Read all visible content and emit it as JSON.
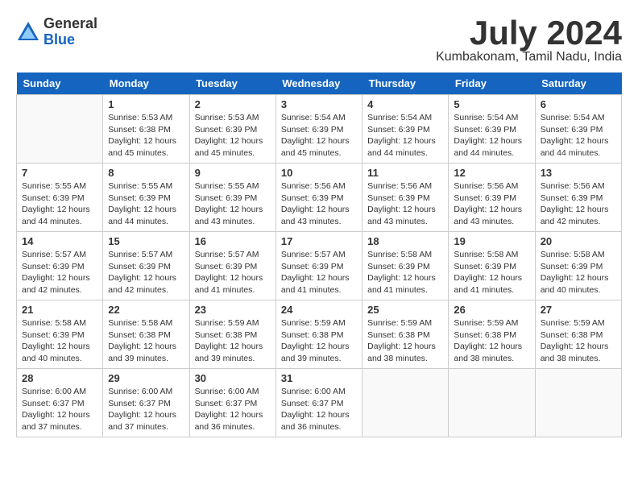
{
  "logo": {
    "general": "General",
    "blue": "Blue"
  },
  "title": "July 2024",
  "location": "Kumbakonam, Tamil Nadu, India",
  "headers": [
    "Sunday",
    "Monday",
    "Tuesday",
    "Wednesday",
    "Thursday",
    "Friday",
    "Saturday"
  ],
  "weeks": [
    [
      {
        "day": "",
        "info": ""
      },
      {
        "day": "1",
        "info": "Sunrise: 5:53 AM\nSunset: 6:38 PM\nDaylight: 12 hours\nand 45 minutes."
      },
      {
        "day": "2",
        "info": "Sunrise: 5:53 AM\nSunset: 6:39 PM\nDaylight: 12 hours\nand 45 minutes."
      },
      {
        "day": "3",
        "info": "Sunrise: 5:54 AM\nSunset: 6:39 PM\nDaylight: 12 hours\nand 45 minutes."
      },
      {
        "day": "4",
        "info": "Sunrise: 5:54 AM\nSunset: 6:39 PM\nDaylight: 12 hours\nand 44 minutes."
      },
      {
        "day": "5",
        "info": "Sunrise: 5:54 AM\nSunset: 6:39 PM\nDaylight: 12 hours\nand 44 minutes."
      },
      {
        "day": "6",
        "info": "Sunrise: 5:54 AM\nSunset: 6:39 PM\nDaylight: 12 hours\nand 44 minutes."
      }
    ],
    [
      {
        "day": "7",
        "info": "Sunrise: 5:55 AM\nSunset: 6:39 PM\nDaylight: 12 hours\nand 44 minutes."
      },
      {
        "day": "8",
        "info": "Sunrise: 5:55 AM\nSunset: 6:39 PM\nDaylight: 12 hours\nand 44 minutes."
      },
      {
        "day": "9",
        "info": "Sunrise: 5:55 AM\nSunset: 6:39 PM\nDaylight: 12 hours\nand 43 minutes."
      },
      {
        "day": "10",
        "info": "Sunrise: 5:56 AM\nSunset: 6:39 PM\nDaylight: 12 hours\nand 43 minutes."
      },
      {
        "day": "11",
        "info": "Sunrise: 5:56 AM\nSunset: 6:39 PM\nDaylight: 12 hours\nand 43 minutes."
      },
      {
        "day": "12",
        "info": "Sunrise: 5:56 AM\nSunset: 6:39 PM\nDaylight: 12 hours\nand 43 minutes."
      },
      {
        "day": "13",
        "info": "Sunrise: 5:56 AM\nSunset: 6:39 PM\nDaylight: 12 hours\nand 42 minutes."
      }
    ],
    [
      {
        "day": "14",
        "info": "Sunrise: 5:57 AM\nSunset: 6:39 PM\nDaylight: 12 hours\nand 42 minutes."
      },
      {
        "day": "15",
        "info": "Sunrise: 5:57 AM\nSunset: 6:39 PM\nDaylight: 12 hours\nand 42 minutes."
      },
      {
        "day": "16",
        "info": "Sunrise: 5:57 AM\nSunset: 6:39 PM\nDaylight: 12 hours\nand 41 minutes."
      },
      {
        "day": "17",
        "info": "Sunrise: 5:57 AM\nSunset: 6:39 PM\nDaylight: 12 hours\nand 41 minutes."
      },
      {
        "day": "18",
        "info": "Sunrise: 5:58 AM\nSunset: 6:39 PM\nDaylight: 12 hours\nand 41 minutes."
      },
      {
        "day": "19",
        "info": "Sunrise: 5:58 AM\nSunset: 6:39 PM\nDaylight: 12 hours\nand 41 minutes."
      },
      {
        "day": "20",
        "info": "Sunrise: 5:58 AM\nSunset: 6:39 PM\nDaylight: 12 hours\nand 40 minutes."
      }
    ],
    [
      {
        "day": "21",
        "info": "Sunrise: 5:58 AM\nSunset: 6:39 PM\nDaylight: 12 hours\nand 40 minutes."
      },
      {
        "day": "22",
        "info": "Sunrise: 5:58 AM\nSunset: 6:38 PM\nDaylight: 12 hours\nand 39 minutes."
      },
      {
        "day": "23",
        "info": "Sunrise: 5:59 AM\nSunset: 6:38 PM\nDaylight: 12 hours\nand 39 minutes."
      },
      {
        "day": "24",
        "info": "Sunrise: 5:59 AM\nSunset: 6:38 PM\nDaylight: 12 hours\nand 39 minutes."
      },
      {
        "day": "25",
        "info": "Sunrise: 5:59 AM\nSunset: 6:38 PM\nDaylight: 12 hours\nand 38 minutes."
      },
      {
        "day": "26",
        "info": "Sunrise: 5:59 AM\nSunset: 6:38 PM\nDaylight: 12 hours\nand 38 minutes."
      },
      {
        "day": "27",
        "info": "Sunrise: 5:59 AM\nSunset: 6:38 PM\nDaylight: 12 hours\nand 38 minutes."
      }
    ],
    [
      {
        "day": "28",
        "info": "Sunrise: 6:00 AM\nSunset: 6:37 PM\nDaylight: 12 hours\nand 37 minutes."
      },
      {
        "day": "29",
        "info": "Sunrise: 6:00 AM\nSunset: 6:37 PM\nDaylight: 12 hours\nand 37 minutes."
      },
      {
        "day": "30",
        "info": "Sunrise: 6:00 AM\nSunset: 6:37 PM\nDaylight: 12 hours\nand 36 minutes."
      },
      {
        "day": "31",
        "info": "Sunrise: 6:00 AM\nSunset: 6:37 PM\nDaylight: 12 hours\nand 36 minutes."
      },
      {
        "day": "",
        "info": ""
      },
      {
        "day": "",
        "info": ""
      },
      {
        "day": "",
        "info": ""
      }
    ]
  ]
}
